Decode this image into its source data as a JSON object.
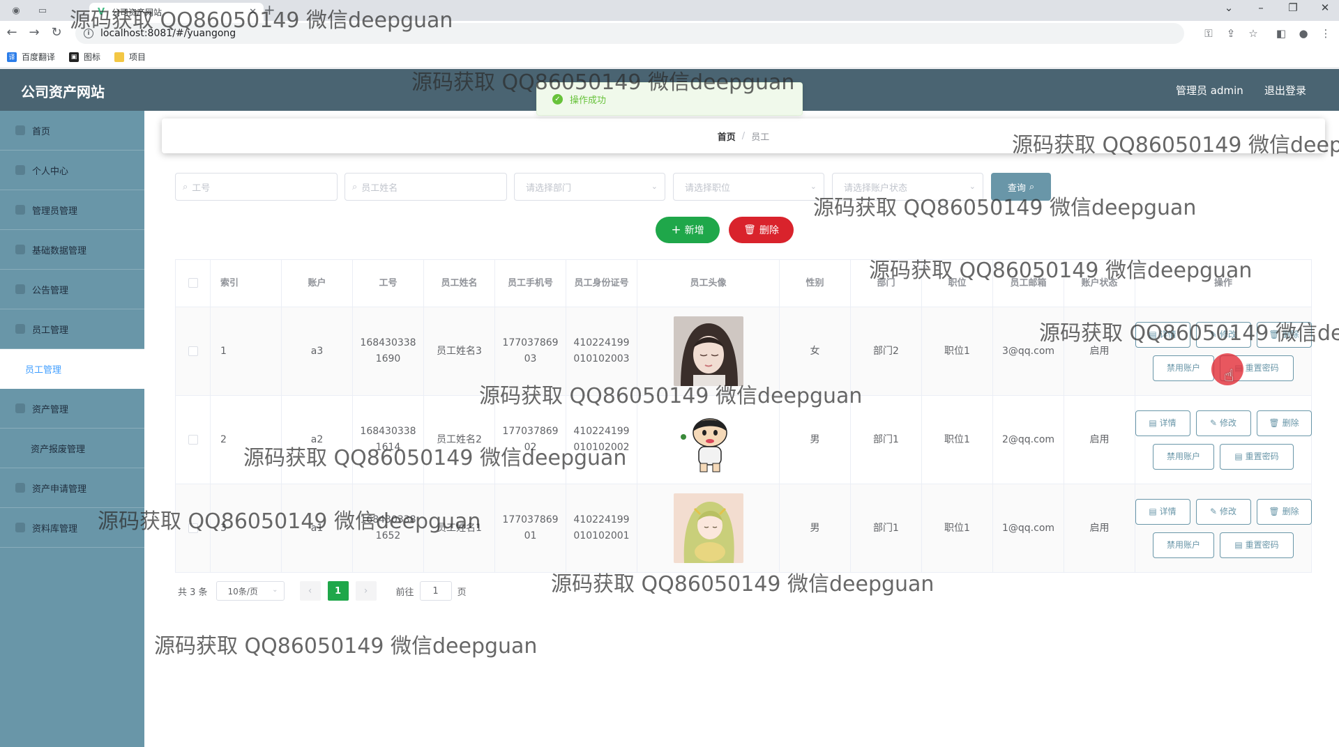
{
  "browser": {
    "tab_title": "公司资产网站",
    "url": "localhost:8081/#/yuangong",
    "bookmarks": [
      "百度翻译",
      "图标",
      "项目"
    ]
  },
  "header": {
    "logo": "公司资产网站",
    "user": "管理员 admin",
    "logout": "退出登录"
  },
  "sidebar": {
    "items": [
      {
        "label": "首页"
      },
      {
        "label": "个人中心"
      },
      {
        "label": "管理员管理"
      },
      {
        "label": "基础数据管理"
      },
      {
        "label": "公告管理"
      },
      {
        "label": "员工管理"
      },
      {
        "label": "员工管理"
      },
      {
        "label": "资产管理"
      },
      {
        "label": "资产报废管理"
      },
      {
        "label": "资产申请管理"
      },
      {
        "label": "资料库管理"
      }
    ]
  },
  "toast": {
    "message": "操作成功"
  },
  "breadcrumb": {
    "home": "首页",
    "separator": "/",
    "current": "员工"
  },
  "search": {
    "gonghao_placeholder": "工号",
    "name_placeholder": "员工姓名",
    "dept_placeholder": "请选择部门",
    "position_placeholder": "请选择职位",
    "status_placeholder": "请选择账户状态",
    "query_label": "查询"
  },
  "actions": {
    "add_label": "新增",
    "delete_label": "删除"
  },
  "table": {
    "headers": [
      "索引",
      "账户",
      "工号",
      "员工姓名",
      "员工手机号",
      "员工身份证号",
      "员工头像",
      "性别",
      "部门",
      "职位",
      "员工邮箱",
      "账户状态",
      "操作"
    ],
    "rows": [
      {
        "index": "1",
        "account": "a3",
        "gonghao": "1684303381690",
        "name": "员工姓名3",
        "phone": "17703786903",
        "idcard": "410224199010102003",
        "gender": "女",
        "dept": "部门2",
        "position": "职位1",
        "email": "3@qq.com",
        "status": "启用"
      },
      {
        "index": "2",
        "account": "a2",
        "gonghao": "1684303381614",
        "name": "员工姓名2",
        "phone": "17703786902",
        "idcard": "410224199010102002",
        "gender": "男",
        "dept": "部门1",
        "position": "职位1",
        "email": "2@qq.com",
        "status": "启用"
      },
      {
        "index": "3",
        "account": "a1",
        "gonghao": "1684303381652",
        "name": "员工姓名1",
        "phone": "17703786901",
        "idcard": "410224199010102001",
        "gender": "男",
        "dept": "部门1",
        "position": "职位1",
        "email": "1@qq.com",
        "status": "启用"
      }
    ],
    "ops": {
      "detail": "详情",
      "edit": "修改",
      "delete": "删除",
      "disable": "禁用账户",
      "reset": "重置密码"
    }
  },
  "pager": {
    "total": "共 3 条",
    "page_size": "10条/页",
    "current_page": "1",
    "goto_prefix": "前往",
    "goto_value": "1",
    "goto_suffix": "页"
  },
  "watermark": "源码获取 QQ86050149 微信deepguan",
  "colors": {
    "header_bg": "#4a6472",
    "sidebar_bg": "#6996a8",
    "primary_green": "#1fa74a",
    "danger_red": "#d9232c",
    "accent": "#6996a8"
  }
}
